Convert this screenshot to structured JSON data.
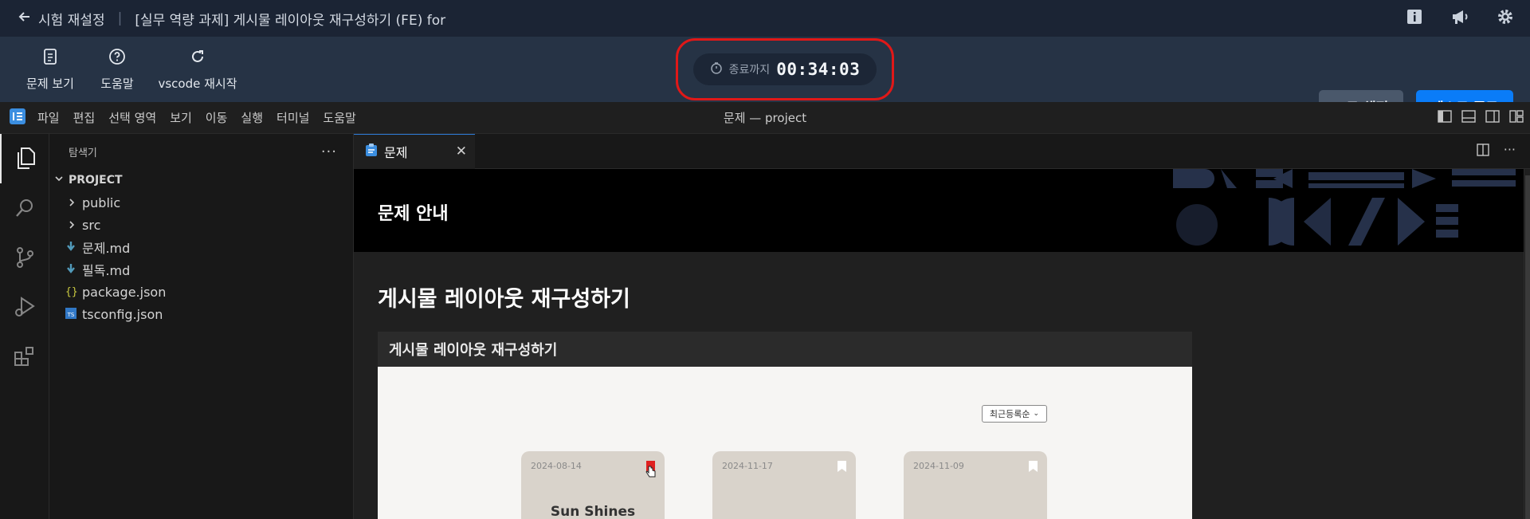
{
  "topbar": {
    "back_label": "시험 재설정",
    "title": "[실무 역량 과제] 게시물 레이아웃 재구성하기 (FE) for",
    "icons": [
      "book-icon",
      "megaphone-icon",
      "gear-icon"
    ]
  },
  "toolbar": {
    "problem_label": "문제 보기",
    "help_label": "도움말",
    "restart_label": "vscode 재시작",
    "timer_label": "종료까지",
    "timer_value": "00:34:03",
    "grade_label": "코드 채점",
    "end_label": "테스트 종료"
  },
  "menubar": {
    "items": [
      "파일",
      "편집",
      "선택 영역",
      "보기",
      "이동",
      "실행",
      "터미널",
      "도움말"
    ],
    "window_title": "문제 — project"
  },
  "explorer": {
    "header": "탐색기",
    "project": "PROJECT",
    "items": [
      {
        "label": "public",
        "kind": "folder"
      },
      {
        "label": "src",
        "kind": "folder"
      },
      {
        "label": "문제.md",
        "kind": "md"
      },
      {
        "label": "필독.md",
        "kind": "md"
      },
      {
        "label": "package.json",
        "kind": "json"
      },
      {
        "label": "tsconfig.json",
        "kind": "ts"
      }
    ]
  },
  "editor": {
    "tab_label": "문제",
    "banner_title": "문제 안내",
    "heading": "게시물 레이아웃 재구성하기",
    "image_caption": "게시물 레이아웃 재구성하기",
    "preview": {
      "sort_label": "최근등록순",
      "cards": [
        {
          "date": "2024-08-14",
          "title": "Sun Shines",
          "bookmarked": true
        },
        {
          "date": "2024-11-17",
          "title": "",
          "bookmarked": false
        },
        {
          "date": "2024-11-09",
          "title": "",
          "bookmarked": false
        }
      ]
    }
  },
  "colors": {
    "accent": "#0a7cf8",
    "timer_highlight": "#e01818",
    "bookmark_active": "#e02020"
  }
}
